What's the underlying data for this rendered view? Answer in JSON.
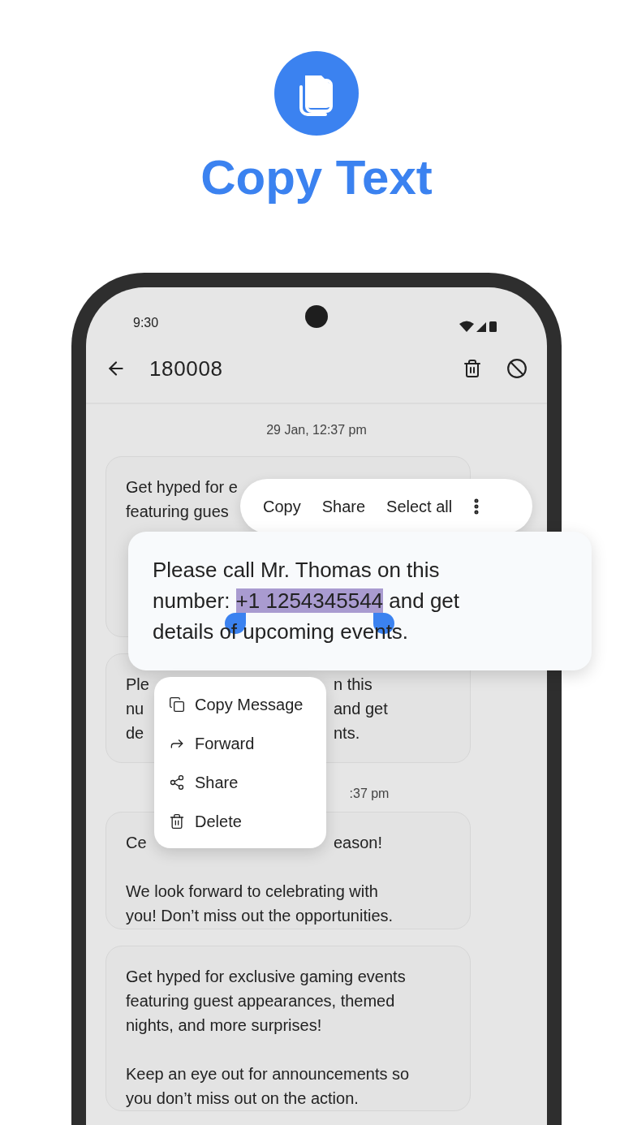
{
  "promo": {
    "title": "Copy Text"
  },
  "status_bar": {
    "time": "9:30"
  },
  "app_bar": {
    "title": "180008"
  },
  "messages": [
    {
      "kind": "date",
      "text": "29 Jan, 12:37 pm"
    },
    {
      "kind": "bubble",
      "rows": [
        {
          "left": "Get hyped for e"
        },
        {
          "left": "featuring gues"
        }
      ]
    },
    {
      "kind": "bubble",
      "rows": [
        {
          "left": "Ple",
          "right": "n this"
        },
        {
          "left": "nu",
          "right": "and get"
        },
        {
          "left": "de",
          "right": "nts."
        }
      ]
    },
    {
      "kind": "date",
      "text": ":37 pm"
    },
    {
      "kind": "bubble",
      "rows": [
        {
          "left": "Ce",
          "right": "eason!"
        }
      ],
      "paragraphs": [
        "We look forward to celebrating with you! Don’t miss out the opportunities."
      ]
    },
    {
      "kind": "bubble",
      "paragraphs": [
        "Get hyped for exclusive gaming events featuring guest appearances, themed nights, and more surprises!",
        "Keep an eye out for announcements so you don’t miss out on the action."
      ]
    }
  ],
  "selection_toolbar": {
    "actions": [
      "Copy",
      "Share",
      "Select all"
    ]
  },
  "selected_text": {
    "before": "Please call Mr. Thomas on this number: ",
    "selection": "+1 1254345544",
    "after": " and get details of upcoming events."
  },
  "context_menu": {
    "items": [
      {
        "kind": "copy",
        "label": "Copy Message"
      },
      {
        "kind": "forward",
        "label": "Forward"
      },
      {
        "kind": "share",
        "label": "Share"
      },
      {
        "kind": "delete",
        "label": "Delete"
      }
    ]
  }
}
